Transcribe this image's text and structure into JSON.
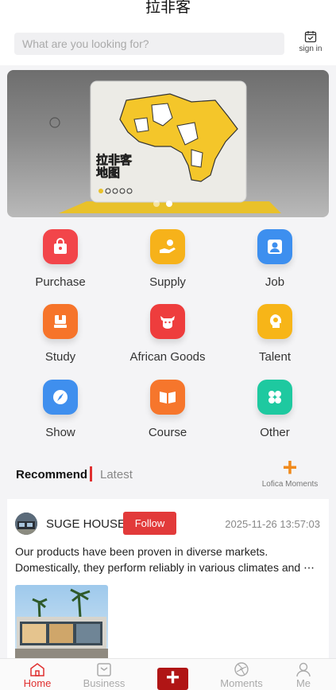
{
  "header": {
    "title": "拉非客",
    "search_placeholder": "What are you looking for?",
    "signin_label": "sign in"
  },
  "banner": {
    "text_line1": "拉非客",
    "text_line2": "地图",
    "slides": 2,
    "active_slide": 2
  },
  "categories": [
    {
      "label": "Purchase",
      "icon": "shopping-bag-icon",
      "color": "#f2454a"
    },
    {
      "label": "Supply",
      "icon": "supply-hand-icon",
      "color": "#f6b21a"
    },
    {
      "label": "Job",
      "icon": "person-badge-icon",
      "color": "#3d8fef"
    },
    {
      "label": "Study",
      "icon": "book-stack-icon",
      "color": "#f6742a"
    },
    {
      "label": "African Goods",
      "icon": "cow-icon",
      "color": "#ee3d3d"
    },
    {
      "label": "Talent",
      "icon": "head-idea-icon",
      "color": "#f7b518"
    },
    {
      "label": "Show",
      "icon": "compass-icon",
      "color": "#3f8fee"
    },
    {
      "label": "Course",
      "icon": "open-book-icon",
      "color": "#f6762c"
    },
    {
      "label": "Other",
      "icon": "four-dots-icon",
      "color": "#1ec9a0"
    }
  ],
  "feed_tabs": {
    "recommend": "Recommend",
    "latest": "Latest",
    "moments_plus": "+",
    "moments_link": "Lofica Moments"
  },
  "post": {
    "author": "SUGE HOUSE",
    "follow_label": "Follow",
    "time": "2025-11-26 13:57:03",
    "text": "Our products have been proven in diverse markets. Domestically, they perform reliably in various climates and ⋯"
  },
  "bottom_nav": {
    "home": "Home",
    "business": "Business",
    "add": "+",
    "moments": "Moments",
    "me": "Me"
  },
  "colors": {
    "accent_red": "#e03030",
    "follow_red": "#e23a3a",
    "add_button": "#b01515",
    "moments_orange": "#f08a1c"
  }
}
